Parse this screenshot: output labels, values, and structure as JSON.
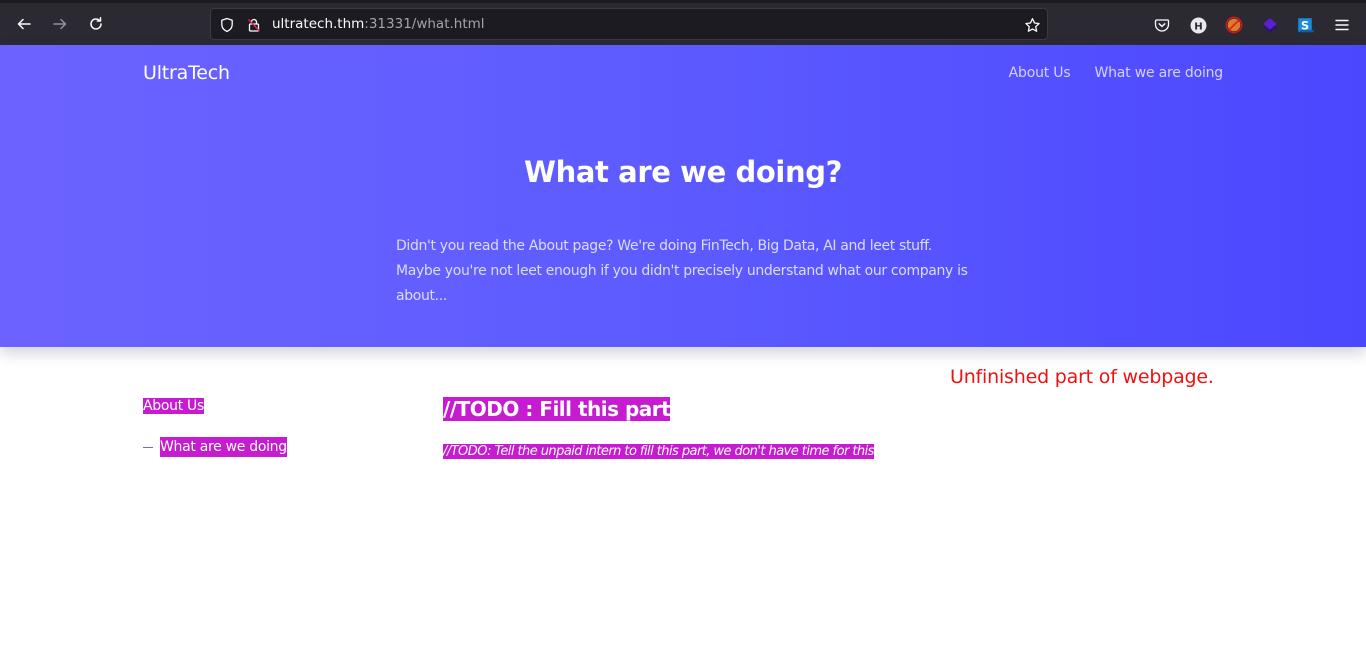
{
  "browser": {
    "url_host": "ultratech.thm",
    "url_rest": ":31331/what.html",
    "toolbar_icons": [
      "back-icon",
      "forward-icon",
      "reload-icon",
      "tracking-protection-shield-icon",
      "insecure-lock-icon",
      "bookmark-star-icon",
      "pocket-icon",
      "extension-h-icon",
      "extension-blocked-icon",
      "extension-layers-icon",
      "extension-s-icon",
      "menu-hamburger-icon"
    ]
  },
  "header": {
    "brand": "UltraTech",
    "nav": [
      {
        "label": "About Us"
      },
      {
        "label": "What we are doing"
      }
    ]
  },
  "hero": {
    "title": "What are we doing?",
    "text": "Didn't you read the About page? We're doing FinTech, Big Data, AI and leet stuff. Maybe you're not leet enough if you didn't precisely understand what our company is about..."
  },
  "sidebar": {
    "items": [
      {
        "label": "About Us",
        "active": false
      },
      {
        "label": "What are we doing",
        "active": true
      }
    ]
  },
  "main": {
    "heading": "//TODO : Fill this part",
    "text": "//TODO: Tell the unpaid intern to fill this part, we don't have time for this"
  },
  "annotation": "Unfinished part of webpage.",
  "colors": {
    "gradient_start": "#6c63ff",
    "gradient_end": "#4b47ff",
    "highlight": "#c61bd0",
    "annotation": "#ee1111"
  }
}
